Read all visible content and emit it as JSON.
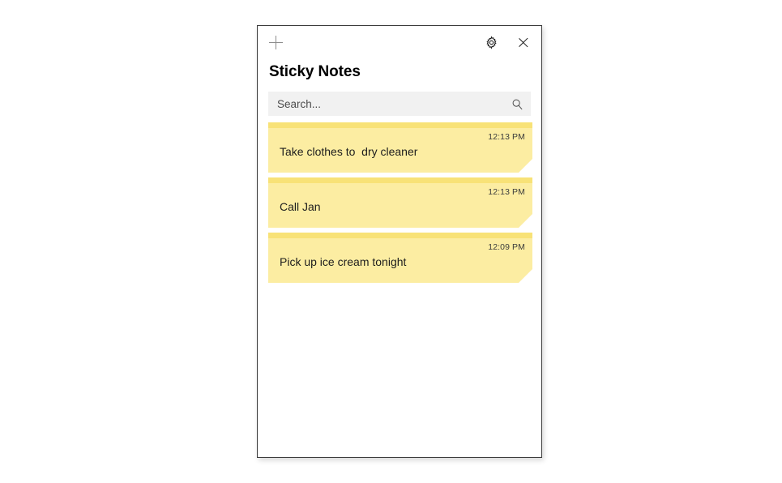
{
  "window": {
    "title": "Sticky Notes",
    "background_color": "#ffffff",
    "border_color": "#3c3c3c"
  },
  "titlebar": {
    "new_note_label": "+",
    "new_note_icon": "plus-icon",
    "settings_icon": "gear-icon",
    "close_icon": "close-icon"
  },
  "search": {
    "placeholder": "Search...",
    "value": "",
    "icon": "search-icon",
    "background_color": "#f1f1f1"
  },
  "notes": {
    "body_color": "#fceda2",
    "strip_color": "#f8e277",
    "fold_color": "#f3e091",
    "items": [
      {
        "text": "Take clothes to  dry cleaner",
        "time": "12:13 PM"
      },
      {
        "text": "Call Jan",
        "time": "12:13 PM"
      },
      {
        "text": "Pick up ice cream tonight",
        "time": "12:09 PM"
      }
    ]
  }
}
